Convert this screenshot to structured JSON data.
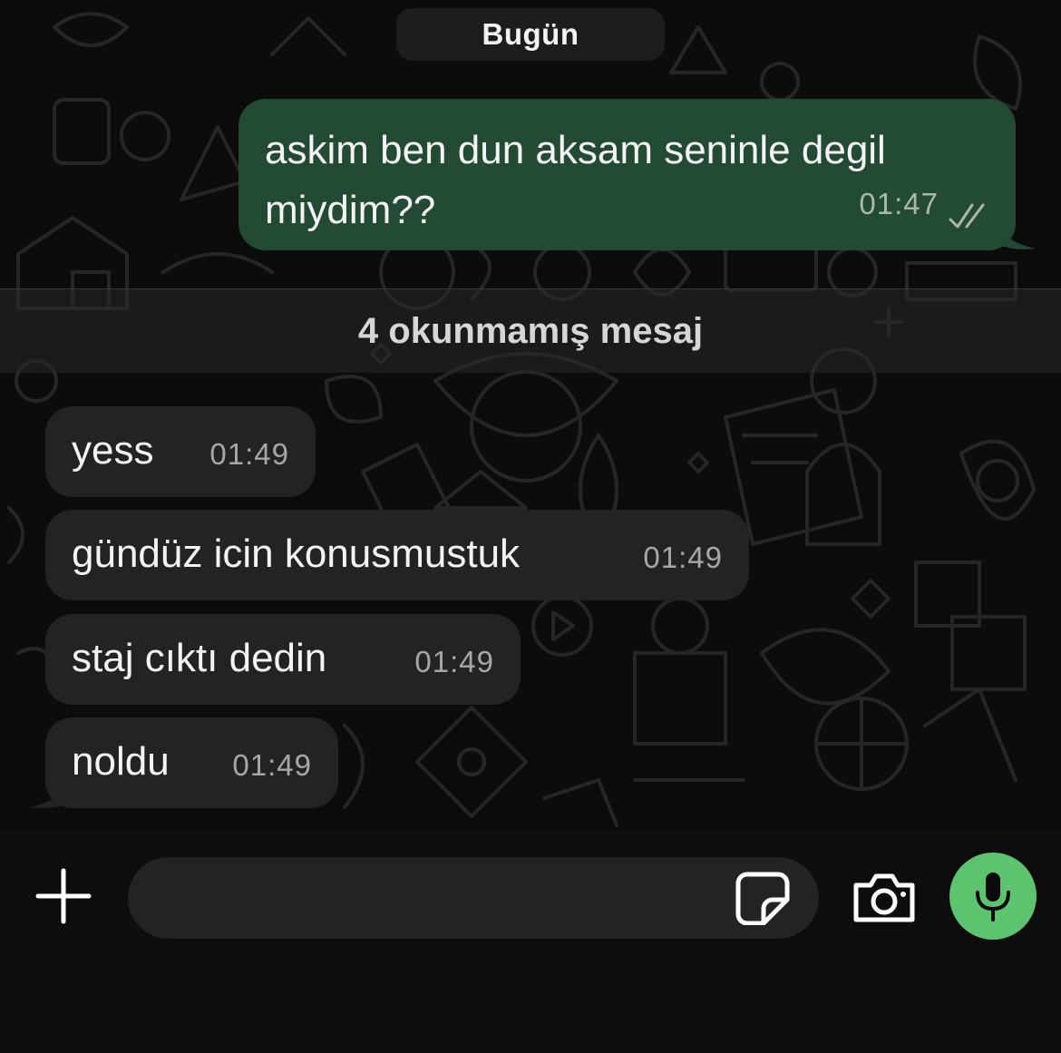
{
  "chat": {
    "date_label": "Bugün",
    "outgoing": {
      "text": "askim ben dun aksam seninle degil miydim??",
      "time": "01:47",
      "status_icon": "double-check-icon"
    },
    "unread_label": "4 okunmamış mesaj",
    "incoming": [
      {
        "text": "yess",
        "time": "01:49"
      },
      {
        "text": "gündüz icin konusmustuk",
        "time": "01:49"
      },
      {
        "text": "staj cıktı dedin",
        "time": "01:49"
      },
      {
        "text": "noldu",
        "time": "01:49"
      }
    ]
  },
  "composer": {
    "placeholder": "",
    "icons": {
      "attach": "plus-icon",
      "sticker": "sticker-icon",
      "camera": "camera-icon",
      "mic": "microphone-icon"
    }
  },
  "colors": {
    "outgoing_bubble": "#234a35",
    "incoming_bubble": "#232323",
    "mic_button": "#5cc36e",
    "background": "#0c0c0c"
  }
}
